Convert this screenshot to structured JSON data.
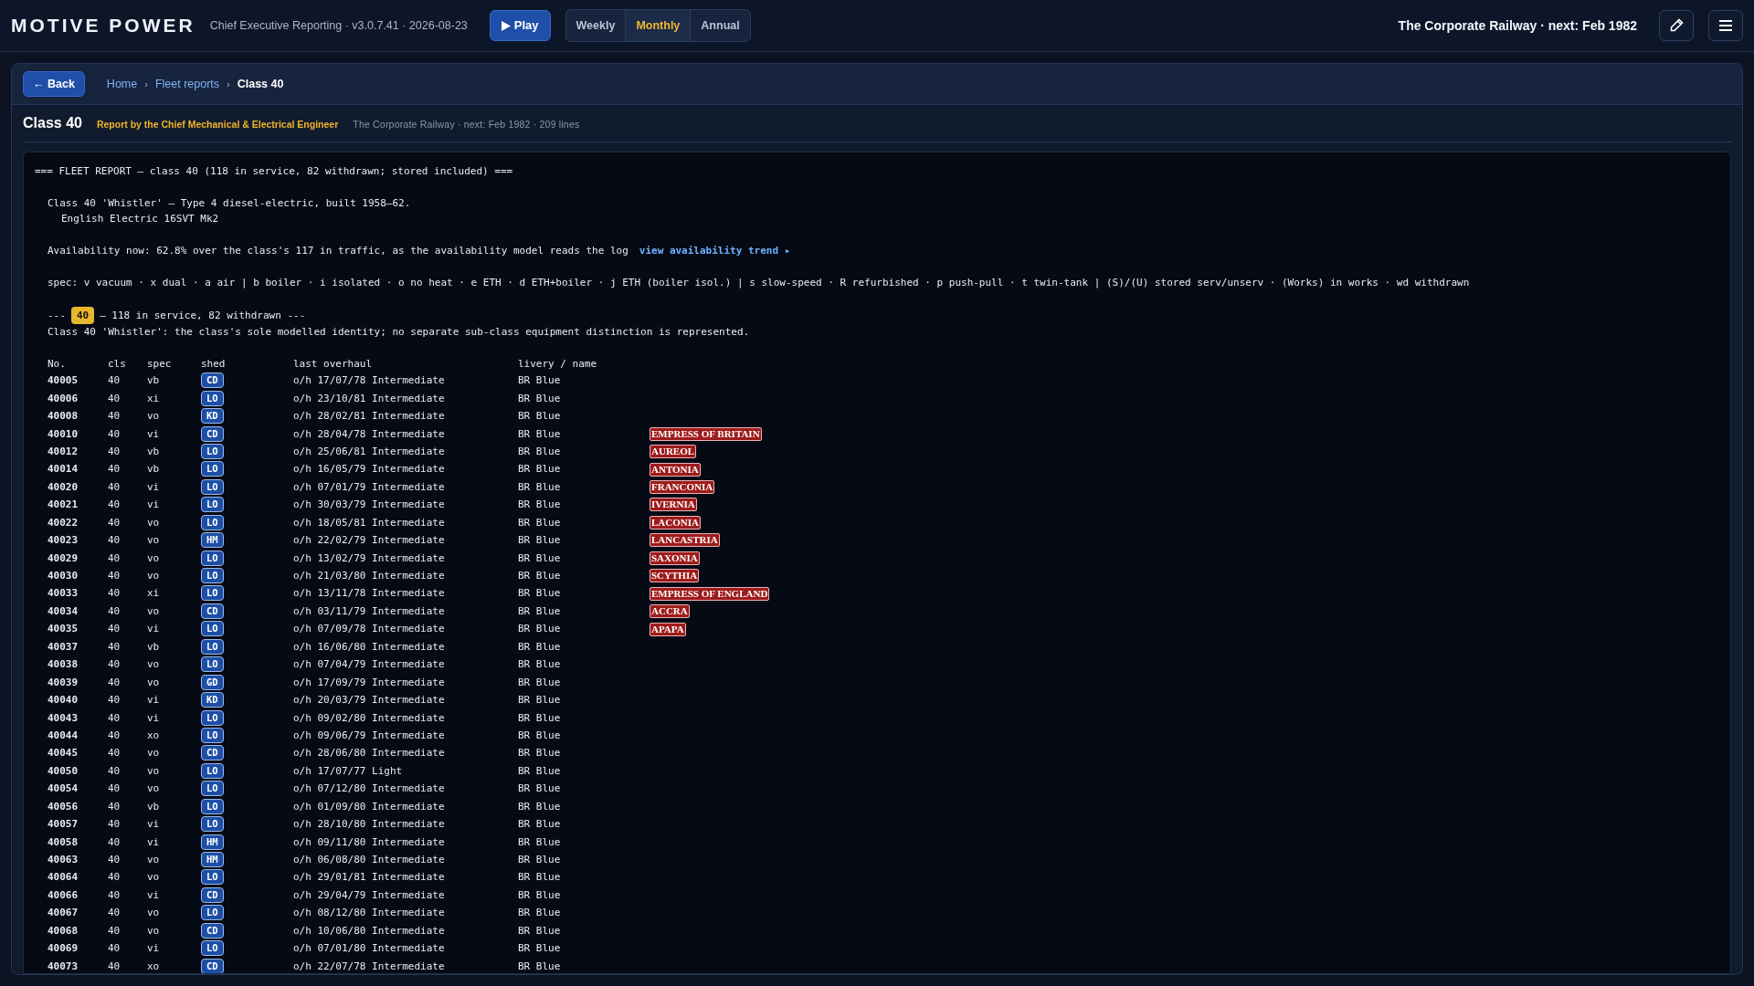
{
  "header": {
    "brand": "MOTIVE POWER",
    "subtitle": "Chief Executive Reporting · v3.0.7.41 · 2026-08-23",
    "play": "Play",
    "periods": [
      {
        "label": "Weekly",
        "selected": false
      },
      {
        "label": "Monthly",
        "selected": true
      },
      {
        "label": "Annual",
        "selected": false
      }
    ],
    "railway": "The Corporate Railway · next: Feb 1982"
  },
  "breadcrumb": {
    "back": "← Back",
    "items": [
      {
        "label": "Home",
        "current": false
      },
      {
        "label": "Fleet reports",
        "current": false
      },
      {
        "label": "Class 40",
        "current": true
      }
    ],
    "separator": "›"
  },
  "title": {
    "heading": "Class 40",
    "author": "Report by the Chief Mechanical & Electrical Engineer",
    "meta": "The Corporate Railway · next: Feb 1982 · 209 lines"
  },
  "report": {
    "title_line": "=== FLEET REPORT — class 40 (118 in service, 82 withdrawn; stored included) ===",
    "description": [
      "Class 40 'Whistler' — Type 4 diesel-electric, built 1958–62.",
      "English Electric 16SVT Mk2"
    ],
    "availability": "Availability now: 62.8% over the class's 117 in traffic, as the availability model reads the log",
    "trend_link": "view availability trend ▸",
    "spec": "spec: v vacuum · x dual · a air | b boiler · i isolated · o no heat · e ETH · d ETH+boiler · j ETH (boiler isol.) | s slow-speed · R refurbished · p push-pull · t twin-tank | (S)/(U) stored serv/unserv · (Works) in works · wd withdrawn",
    "section": {
      "prefix": "---",
      "badge": "40",
      "suffix": "— 118 in service, 82 withdrawn ---",
      "note": "Class 40 'Whistler': the class's sole modelled identity; no separate sub-class equipment distinction is represented."
    },
    "columns": [
      "No.",
      "cls",
      "spec",
      "shed",
      "last overhaul",
      "livery / name"
    ],
    "rows": [
      {
        "no": "40005",
        "cls": "40",
        "spec": "vb",
        "shed": "CD",
        "overhaul": "o/h 17/07/78 Intermediate",
        "livery": "BR Blue"
      },
      {
        "no": "40006",
        "cls": "40",
        "spec": "xi",
        "shed": "LO",
        "overhaul": "o/h 23/10/81 Intermediate",
        "livery": "BR Blue"
      },
      {
        "no": "40008",
        "cls": "40",
        "spec": "vo",
        "shed": "KD",
        "overhaul": "o/h 28/02/81 Intermediate",
        "livery": "BR Blue"
      },
      {
        "no": "40010",
        "cls": "40",
        "spec": "vi",
        "shed": "CD",
        "overhaul": "o/h 28/04/78 Intermediate",
        "livery": "BR Blue",
        "name": "EMPRESS OF BRITAIN"
      },
      {
        "no": "40012",
        "cls": "40",
        "spec": "vb",
        "shed": "LO",
        "overhaul": "o/h 25/06/81 Intermediate",
        "livery": "BR Blue",
        "name": "AUREOL"
      },
      {
        "no": "40014",
        "cls": "40",
        "spec": "vb",
        "shed": "LO",
        "overhaul": "o/h 16/05/79 Intermediate",
        "livery": "BR Blue",
        "name": "ANTONIA"
      },
      {
        "no": "40020",
        "cls": "40",
        "spec": "vi",
        "shed": "LO",
        "overhaul": "o/h 07/01/79 Intermediate",
        "livery": "BR Blue",
        "name": "FRANCONIA"
      },
      {
        "no": "40021",
        "cls": "40",
        "spec": "vi",
        "shed": "LO",
        "overhaul": "o/h 30/03/79 Intermediate",
        "livery": "BR Blue",
        "name": "IVERNIA"
      },
      {
        "no": "40022",
        "cls": "40",
        "spec": "vo",
        "shed": "LO",
        "overhaul": "o/h 18/05/81 Intermediate",
        "livery": "BR Blue",
        "name": "LACONIA"
      },
      {
        "no": "40023",
        "cls": "40",
        "spec": "vo",
        "shed": "HM",
        "overhaul": "o/h 22/02/79 Intermediate",
        "livery": "BR Blue",
        "name": "LANCASTRIA"
      },
      {
        "no": "40029",
        "cls": "40",
        "spec": "vo",
        "shed": "LO",
        "overhaul": "o/h 13/02/79 Intermediate",
        "livery": "BR Blue",
        "name": "SAXONIA"
      },
      {
        "no": "40030",
        "cls": "40",
        "spec": "vo",
        "shed": "LO",
        "overhaul": "o/h 21/03/80 Intermediate",
        "livery": "BR Blue",
        "name": "SCYTHIA"
      },
      {
        "no": "40033",
        "cls": "40",
        "spec": "xi",
        "shed": "LO",
        "overhaul": "o/h 13/11/78 Intermediate",
        "livery": "BR Blue",
        "name": "EMPRESS OF ENGLAND"
      },
      {
        "no": "40034",
        "cls": "40",
        "spec": "vo",
        "shed": "CD",
        "overhaul": "o/h 03/11/79 Intermediate",
        "livery": "BR Blue",
        "name": "ACCRA"
      },
      {
        "no": "40035",
        "cls": "40",
        "spec": "vi",
        "shed": "LO",
        "overhaul": "o/h 07/09/78 Intermediate",
        "livery": "BR Blue",
        "name": "APAPA"
      },
      {
        "no": "40037",
        "cls": "40",
        "spec": "vb",
        "shed": "LO",
        "overhaul": "o/h 16/06/80 Intermediate",
        "livery": "BR Blue"
      },
      {
        "no": "40038",
        "cls": "40",
        "spec": "vo",
        "shed": "LO",
        "overhaul": "o/h 07/04/79 Intermediate",
        "livery": "BR Blue"
      },
      {
        "no": "40039",
        "cls": "40",
        "spec": "vo",
        "shed": "GD",
        "overhaul": "o/h 17/09/79 Intermediate",
        "livery": "BR Blue"
      },
      {
        "no": "40040",
        "cls": "40",
        "spec": "vi",
        "shed": "KD",
        "overhaul": "o/h 20/03/79 Intermediate",
        "livery": "BR Blue"
      },
      {
        "no": "40043",
        "cls": "40",
        "spec": "vi",
        "shed": "LO",
        "overhaul": "o/h 09/02/80 Intermediate",
        "livery": "BR Blue"
      },
      {
        "no": "40044",
        "cls": "40",
        "spec": "xo",
        "shed": "LO",
        "overhaul": "o/h 09/06/79 Intermediate",
        "livery": "BR Blue"
      },
      {
        "no": "40045",
        "cls": "40",
        "spec": "vo",
        "shed": "CD",
        "overhaul": "o/h 28/06/80 Intermediate",
        "livery": "BR Blue"
      },
      {
        "no": "40050",
        "cls": "40",
        "spec": "vo",
        "shed": "LO",
        "overhaul": "o/h 17/07/77 Light",
        "livery": "BR Blue"
      },
      {
        "no": "40054",
        "cls": "40",
        "spec": "vo",
        "shed": "LO",
        "overhaul": "o/h 07/12/80 Intermediate",
        "livery": "BR Blue"
      },
      {
        "no": "40056",
        "cls": "40",
        "spec": "vb",
        "shed": "LO",
        "overhaul": "o/h 01/09/80 Intermediate",
        "livery": "BR Blue"
      },
      {
        "no": "40057",
        "cls": "40",
        "spec": "vi",
        "shed": "LO",
        "overhaul": "o/h 28/10/80 Intermediate",
        "livery": "BR Blue"
      },
      {
        "no": "40058",
        "cls": "40",
        "spec": "vi",
        "shed": "HM",
        "overhaul": "o/h 09/11/80 Intermediate",
        "livery": "BR Blue"
      },
      {
        "no": "40063",
        "cls": "40",
        "spec": "vo",
        "shed": "HM",
        "overhaul": "o/h 06/08/80 Intermediate",
        "livery": "BR Blue"
      },
      {
        "no": "40064",
        "cls": "40",
        "spec": "vo",
        "shed": "LO",
        "overhaul": "o/h 29/01/81 Intermediate",
        "livery": "BR Blue"
      },
      {
        "no": "40066",
        "cls": "40",
        "spec": "vi",
        "shed": "CD",
        "overhaul": "o/h 29/04/79 Intermediate",
        "livery": "BR Blue"
      },
      {
        "no": "40067",
        "cls": "40",
        "spec": "vo",
        "shed": "LO",
        "overhaul": "o/h 08/12/80 Intermediate",
        "livery": "BR Blue"
      },
      {
        "no": "40068",
        "cls": "40",
        "spec": "vo",
        "shed": "CD",
        "overhaul": "o/h 10/06/80 Intermediate",
        "livery": "BR Blue"
      },
      {
        "no": "40069",
        "cls": "40",
        "spec": "vi",
        "shed": "LO",
        "overhaul": "o/h 07/01/80 Intermediate",
        "livery": "BR Blue"
      },
      {
        "no": "40073",
        "cls": "40",
        "spec": "xo",
        "shed": "CD",
        "overhaul": "o/h 22/07/78 Intermediate",
        "livery": "BR Blue"
      }
    ]
  }
}
